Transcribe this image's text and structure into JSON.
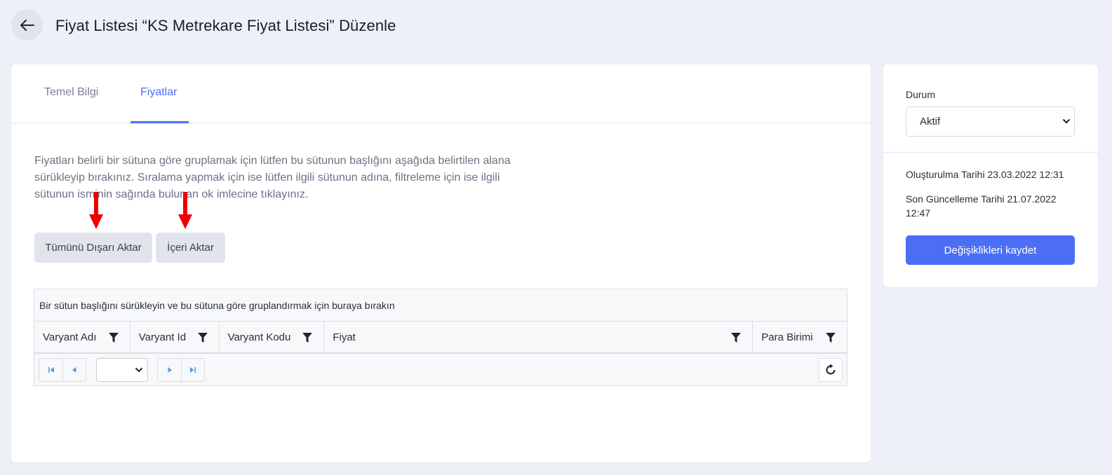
{
  "header": {
    "title": "Fiyat Listesi “KS Metrekare Fiyat Listesi” Düzenle"
  },
  "tabs": [
    {
      "label": "Temel Bilgi",
      "active": false
    },
    {
      "label": "Fiyatlar",
      "active": true
    }
  ],
  "main": {
    "help_text": "Fiyatları belirli bir sütuna göre gruplamak için lütfen bu sütunun başlığını aşağıda belirtilen alana sürükleyip bırakınız. Sıralama yapmak için ise lütfen ilgili sütunun adına, filtreleme için ise ilgili sütunun isminin sağında bulunan ok imlecine tıklayınız.",
    "export_button": "Tümünü Dışarı Aktar",
    "import_button": "İçeri Aktar"
  },
  "grid": {
    "group_panel_text": "Bir sütun başlığını sürükleyin ve bu sütuna göre gruplandırmak için buraya bırakın",
    "columns": [
      "Varyant Adı",
      "Varyant Id",
      "Varyant Kodu",
      "Fiyat",
      "Para Birimi"
    ],
    "page_select_value": ""
  },
  "sidebar": {
    "status_label": "Durum",
    "status_value": "Aktif",
    "created": "Oluşturulma Tarihi 23.03.2022 12:31",
    "updated": "Son Güncelleme Tarihi 21.07.2022 12:47",
    "save_button": "Değişiklikleri kaydet"
  },
  "colors": {
    "accent": "#4c6ef5",
    "annotation_arrow": "#ee0000",
    "background": "#eef0f7"
  },
  "icons": [
    "arrow-left-icon",
    "filter-icon",
    "first-page-icon",
    "prev-page-icon",
    "next-page-icon",
    "last-page-icon",
    "refresh-icon",
    "chevron-down-icon",
    "red-arrow-down-icon"
  ]
}
